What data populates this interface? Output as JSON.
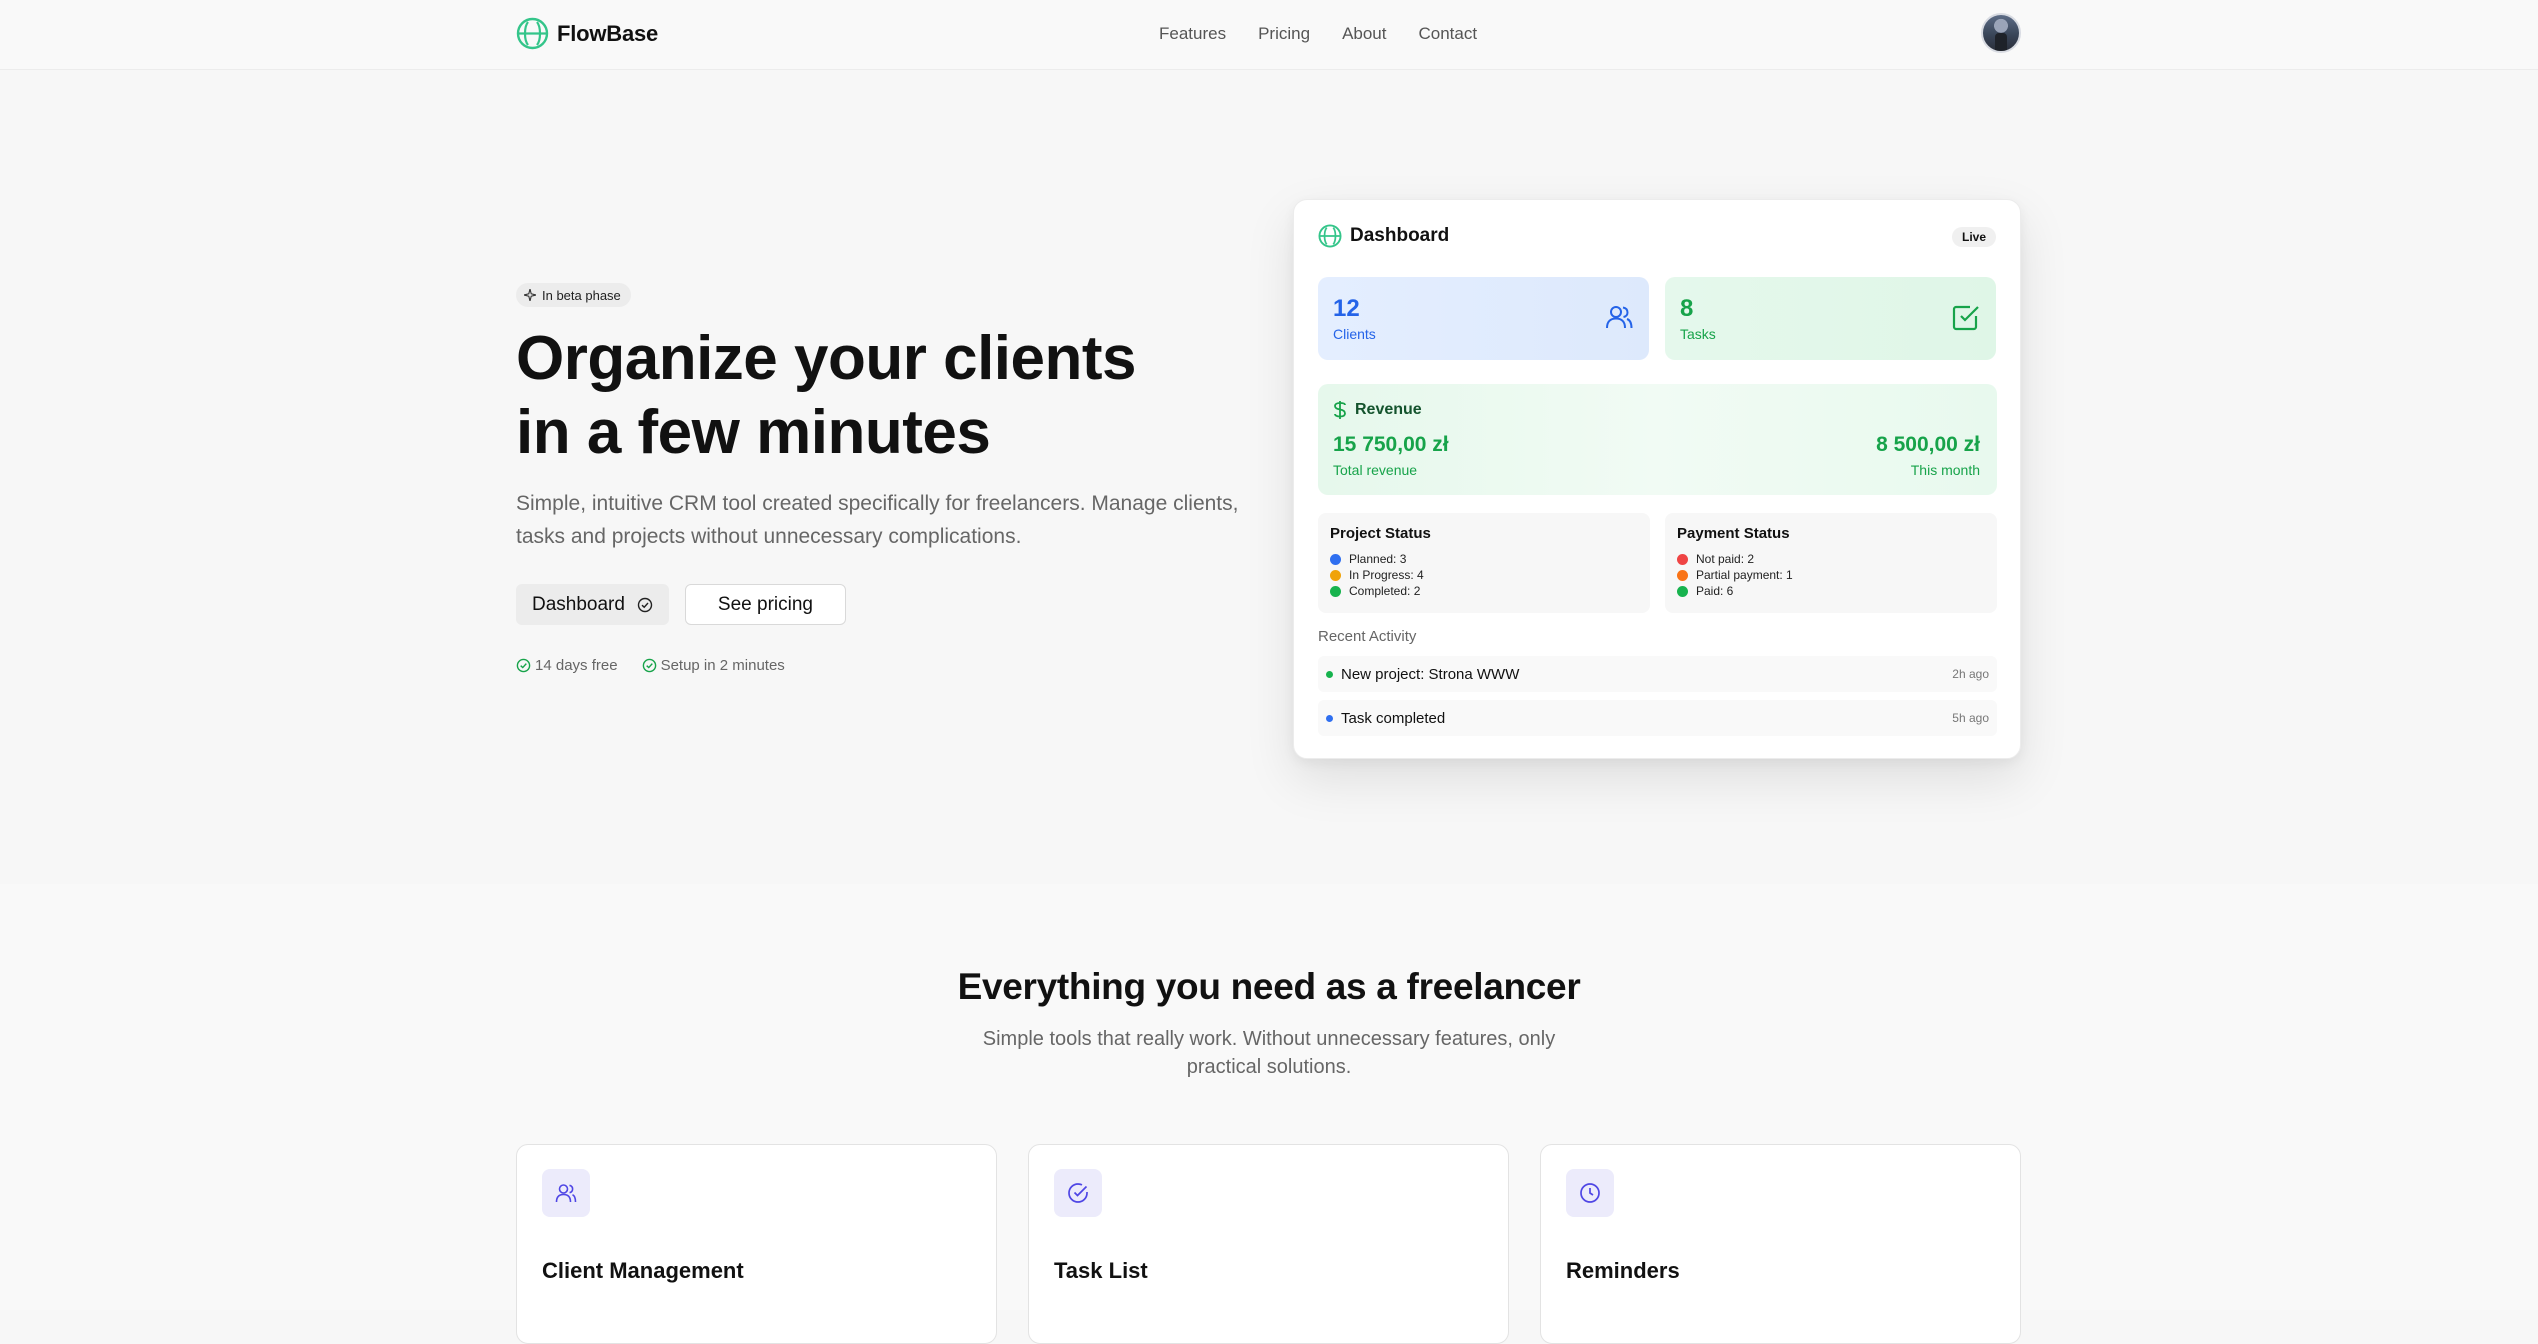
{
  "nav": {
    "brand": "FlowBase",
    "links": [
      "Features",
      "Pricing",
      "About",
      "Contact"
    ]
  },
  "hero": {
    "badge": "In beta phase",
    "title_line1": "Organize your clients",
    "title_line2": "in a few minutes",
    "subtitle_line1": "Simple, intuitive CRM tool created specifically for freelancers. Manage clients,",
    "subtitle_line2": "tasks and projects without unnecessary complications.",
    "primary_button": "Dashboard",
    "secondary_button": "See pricing",
    "perks": [
      "14 days free",
      "Setup in 2 minutes"
    ]
  },
  "dashboard": {
    "title": "Dashboard",
    "live_badge": "Live",
    "clients": {
      "value": "12",
      "label": "Clients"
    },
    "tasks": {
      "value": "8",
      "label": "Tasks"
    },
    "revenue": {
      "title": "Revenue",
      "total": "15 750,00 zł",
      "total_label": "Total revenue",
      "month": "8 500,00 zł",
      "month_label": "This month"
    },
    "project_status": {
      "title": "Project Status",
      "items": [
        "Planned: 3",
        "In Progress: 4",
        "Completed: 2"
      ]
    },
    "payment_status": {
      "title": "Payment Status",
      "items": [
        "Not paid: 2",
        "Partial payment: 1",
        "Paid: 6"
      ]
    },
    "recent_label": "Recent Activity",
    "activity": [
      {
        "text": "New project: Strona WWW",
        "time": "2h ago"
      },
      {
        "text": "Task completed",
        "time": "5h ago"
      }
    ]
  },
  "features": {
    "title": "Everything you need as a freelancer",
    "subtitle_line1": "Simple tools that really work. Without unnecessary features, only",
    "subtitle_line2": "practical solutions.",
    "cards": [
      {
        "title": "Client Management",
        "icon": "users-icon"
      },
      {
        "title": "Task List",
        "icon": "check-circle-icon"
      },
      {
        "title": "Reminders",
        "icon": "clock-icon"
      }
    ]
  },
  "colors": {
    "brand_green": "#34c58a",
    "blue": "#2463e8",
    "green": "#17a34a",
    "amber": "#f0a30a",
    "red": "#ef4444",
    "orange": "#f97316",
    "feature_icon": "#4f46e5"
  }
}
